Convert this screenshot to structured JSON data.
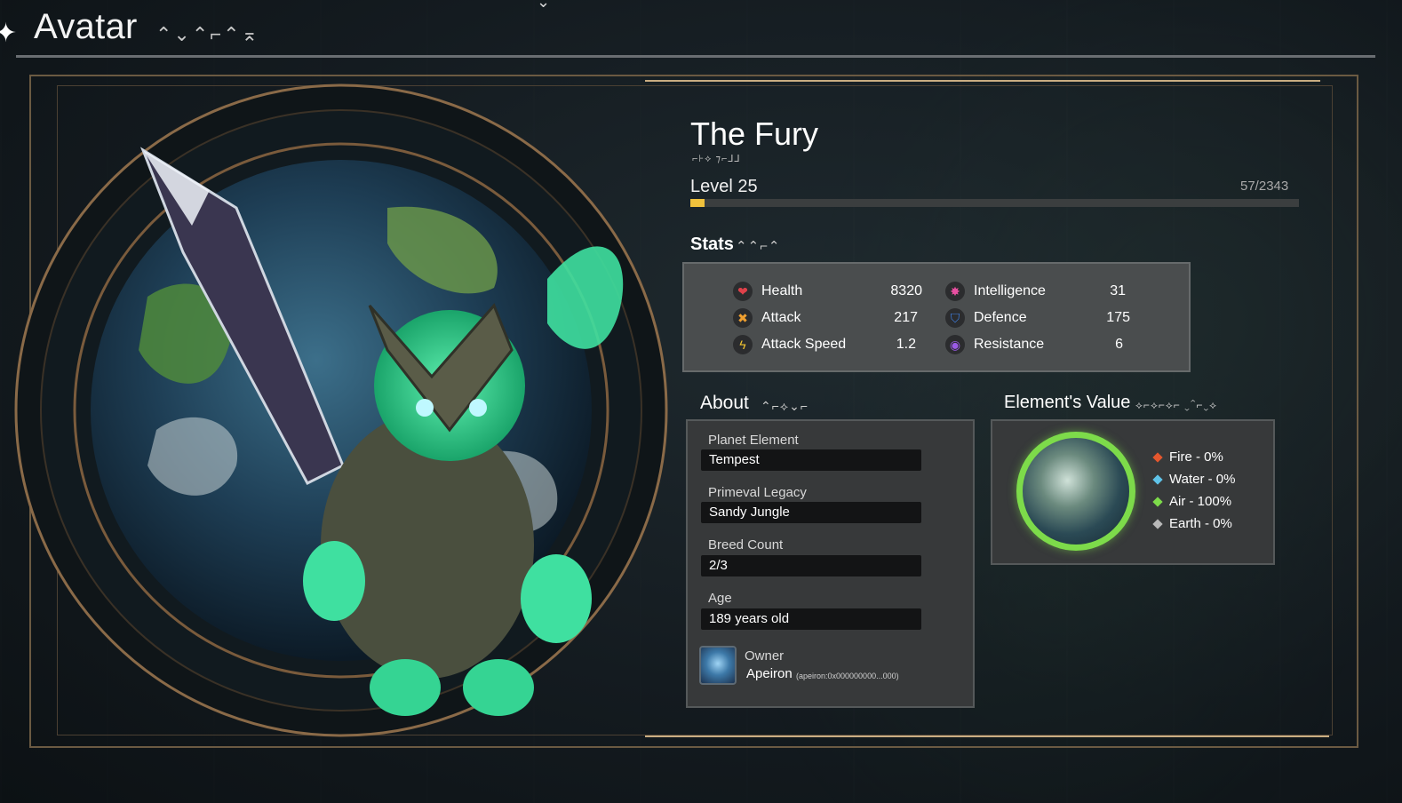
{
  "header": {
    "title": "Avatar",
    "title_rune": "⌃⌄⌃⌐⌃⌅"
  },
  "avatar": {
    "name": "The Fury",
    "name_rune": "⌐⊦⟡ ⁊⌐⅃⅃",
    "level_label": "Level 25",
    "xp_text": "57/2343",
    "xp_progress": 0.024
  },
  "stats": {
    "title": "Stats",
    "title_rune": "⌃⌃⌐⌃",
    "items": [
      {
        "label": "Health",
        "value": "8320",
        "icon": "heart-icon",
        "color": "#e0414a"
      },
      {
        "label": "Attack",
        "value": "217",
        "icon": "attack-icon",
        "color": "#f0a030"
      },
      {
        "label": "Attack Speed",
        "value": "1.2",
        "icon": "lightning-icon",
        "color": "#f2c531"
      },
      {
        "label": "Intelligence",
        "value": "31",
        "icon": "intelligence-icon",
        "color": "#e84fa0"
      },
      {
        "label": "Defence",
        "value": "175",
        "icon": "shield-icon",
        "color": "#3f7fe0"
      },
      {
        "label": "Resistance",
        "value": "6",
        "icon": "resistance-icon",
        "color": "#9b5ae6"
      }
    ]
  },
  "about": {
    "title": "About",
    "title_rune": "⌃⌐⟡⌄⌐",
    "fields": [
      {
        "label": "Planet Element",
        "value": "Tempest"
      },
      {
        "label": "Primeval Legacy",
        "value": "Sandy Jungle"
      },
      {
        "label": "Breed Count",
        "value": "2/3"
      },
      {
        "label": "Age",
        "value": "189 years old"
      }
    ],
    "owner_label": "Owner",
    "owner_name": "Apeiron",
    "owner_address": "(apeiron:0x000000000...000)"
  },
  "elements": {
    "title": "Element's Value",
    "title_rune": "⟡⌐⟡⌐⟡⌐ ⌄⌃⌐⌄⟡",
    "items": [
      {
        "label": "Fire - 0%",
        "color": "#e4572e",
        "value": 0
      },
      {
        "label": "Water - 0%",
        "color": "#5fc3e8",
        "value": 0
      },
      {
        "label": "Air - 100%",
        "color": "#7ddb4a",
        "value": 100
      },
      {
        "label": "Earth - 0%",
        "color": "#b9b9b9",
        "value": 0
      }
    ]
  }
}
